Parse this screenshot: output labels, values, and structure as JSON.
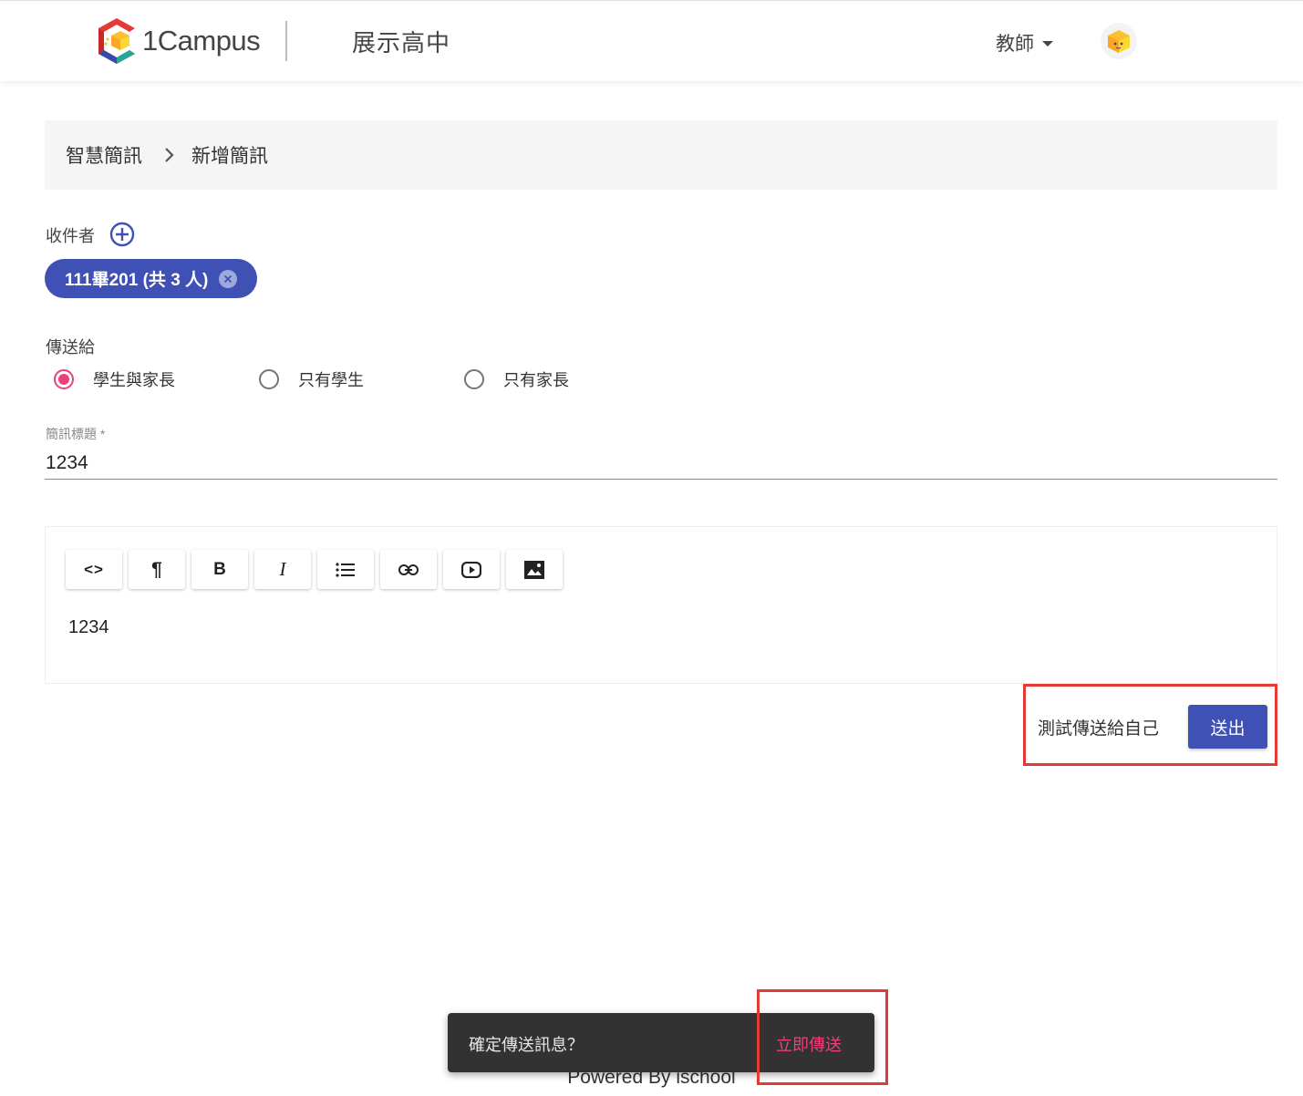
{
  "header": {
    "logo_text": "1Campus",
    "school_name": "展示高中",
    "role_label": "教師",
    "logo_colors": {
      "red": "#e53935",
      "blue": "#3949ab",
      "teal": "#26a69a",
      "yellow": "#fbc02d"
    }
  },
  "breadcrumb": {
    "items": [
      "智慧簡訊",
      "新增簡訊"
    ],
    "separator_icon": "chevron-right-icon"
  },
  "recipients": {
    "label": "收件者",
    "add_icon": "add-circle-icon",
    "chips": [
      {
        "label": "111畢201 (共 3 人)",
        "remove_icon": "cancel-icon"
      }
    ]
  },
  "send_to": {
    "label": "傳送給",
    "options": [
      {
        "label": "學生與家長",
        "selected": true
      },
      {
        "label": "只有學生",
        "selected": false
      },
      {
        "label": "只有家長",
        "selected": false
      }
    ]
  },
  "title_field": {
    "label": "簡訊標題 *",
    "value": "1234"
  },
  "editor": {
    "toolbar": [
      {
        "icon": "code-icon",
        "glyph": "<>"
      },
      {
        "icon": "paragraph-icon",
        "glyph": "¶"
      },
      {
        "icon": "bold-icon",
        "glyph": "B"
      },
      {
        "icon": "italic-icon",
        "glyph": "I"
      },
      {
        "icon": "list-icon"
      },
      {
        "icon": "link-icon"
      },
      {
        "icon": "video-icon"
      },
      {
        "icon": "image-icon"
      }
    ],
    "content": "1234"
  },
  "actions": {
    "test_send": "測試傳送給自己",
    "submit": "送出"
  },
  "snackbar": {
    "message": "確定傳送訊息？",
    "action": "立即傳送"
  },
  "footer": {
    "text": "Powered By ischool"
  },
  "colors": {
    "primary": "#3f51b5",
    "accent": "#ec407a",
    "highlight": "#e53935"
  }
}
